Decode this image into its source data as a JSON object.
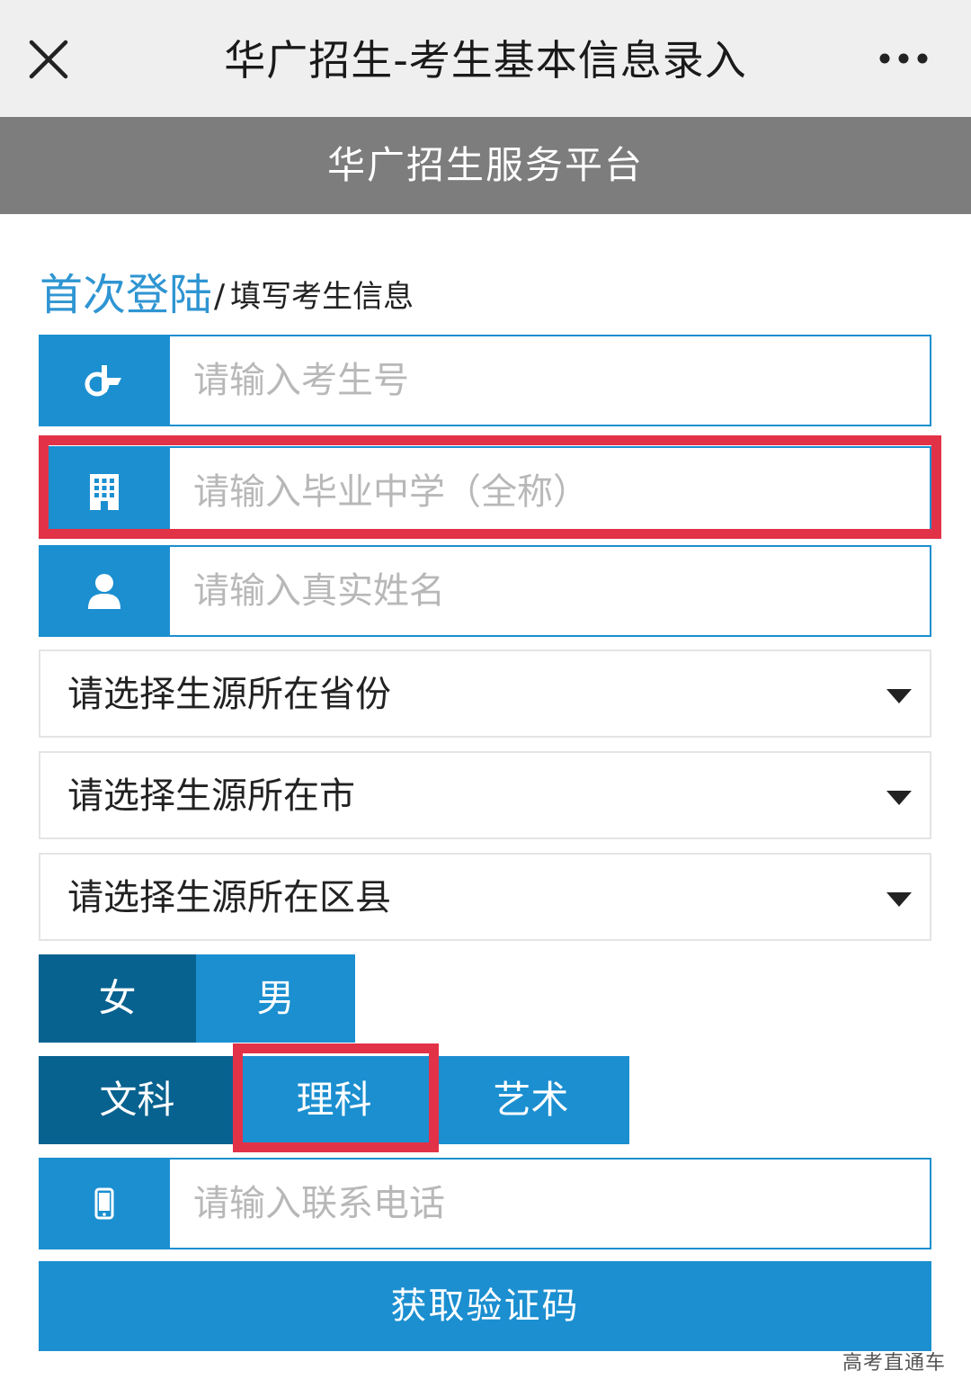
{
  "window": {
    "title": "华广招生-考生基本信息录入",
    "close_icon": "close-icon",
    "more_icon": "more-dots-icon"
  },
  "header": {
    "title": "华广招生服务平台"
  },
  "breadcrumb": {
    "main": "首次登陆",
    "separator": "/",
    "sub": "填写考生信息"
  },
  "fields": {
    "exam_number": {
      "placeholder": "请输入考生号",
      "icon": "exam-number-icon"
    },
    "school": {
      "placeholder": "请输入毕业中学（全称）",
      "icon": "building-icon"
    },
    "name": {
      "placeholder": "请输入真实姓名",
      "icon": "user-icon"
    },
    "phone": {
      "placeholder": "请输入联系电话",
      "icon": "mobile-phone-icon"
    }
  },
  "selects": {
    "province": "请选择生源所在省份",
    "city": "请选择生源所在市",
    "district": "请选择生源所在区县"
  },
  "gender": {
    "options": [
      "女",
      "男"
    ],
    "selected": "女"
  },
  "subject": {
    "options": [
      "文科",
      "理科",
      "艺术"
    ],
    "selected": "文科"
  },
  "buttons": {
    "get_code": "获取验证码"
  },
  "watermark": "高考直通车",
  "colors": {
    "primary": "#1b8fd0",
    "active": "#07628f",
    "highlight": "#e23247",
    "header_gray": "#7d7d7d"
  }
}
